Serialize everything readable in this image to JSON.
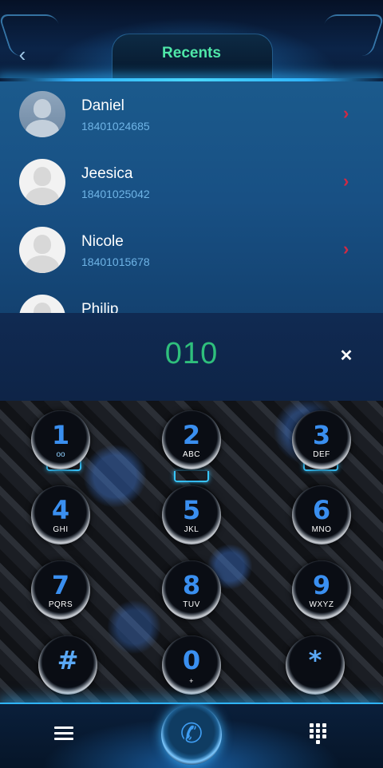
{
  "header": {
    "title": "Recents",
    "back_icon": "chevron-left-icon"
  },
  "recents": [
    {
      "name": "Daniel",
      "number": "18401024685"
    },
    {
      "name": "Jeesica",
      "number": "18401025042"
    },
    {
      "name": "Nicole",
      "number": "18401015678"
    },
    {
      "name": "Philip",
      "number": ""
    }
  ],
  "dialer": {
    "input_value": "010",
    "clear_icon": "close-icon"
  },
  "keypad": {
    "keys": [
      {
        "digit": "1",
        "letters": ""
      },
      {
        "digit": "2",
        "letters": "ABC"
      },
      {
        "digit": "3",
        "letters": "DEF"
      },
      {
        "digit": "4",
        "letters": "GHI"
      },
      {
        "digit": "5",
        "letters": "JKL"
      },
      {
        "digit": "6",
        "letters": "MNO"
      },
      {
        "digit": "7",
        "letters": "PQRS"
      },
      {
        "digit": "8",
        "letters": "TUV"
      },
      {
        "digit": "9",
        "letters": "WXYZ"
      },
      {
        "digit": "#",
        "letters": ""
      },
      {
        "digit": "0",
        "letters": "+"
      },
      {
        "digit": "*",
        "letters": ""
      }
    ]
  },
  "bottom_bar": {
    "menu_icon": "menu-icon",
    "call_icon": "phone-icon",
    "keypad_icon": "dialpad-icon"
  },
  "colors": {
    "accent_green": "#4fe7a8",
    "input_green": "#2fbf7c",
    "digit_blue": "#3a8ff0",
    "chevron_red": "#d02a44",
    "glow_cyan": "#2fb4ff"
  }
}
